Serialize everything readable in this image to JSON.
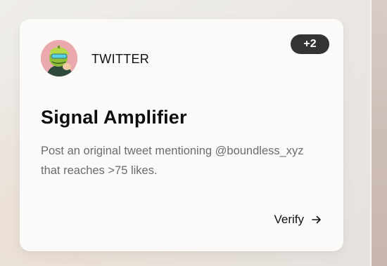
{
  "card": {
    "platform": "TWITTER",
    "badge": "+2",
    "title": "Signal Amplifier",
    "description": "Post an original tweet mentioning @boundless_xyz that reaches >75 likes.",
    "action_label": "Verify",
    "avatar_icon": "pepe-frog-avatar-icon",
    "action_icon": "arrow-right-icon"
  },
  "colors": {
    "badge_bg": "#333331",
    "card_bg": "#fbfaf9",
    "avatar_bg": "#e9a9ad",
    "description_text": "#6b6b6b"
  }
}
